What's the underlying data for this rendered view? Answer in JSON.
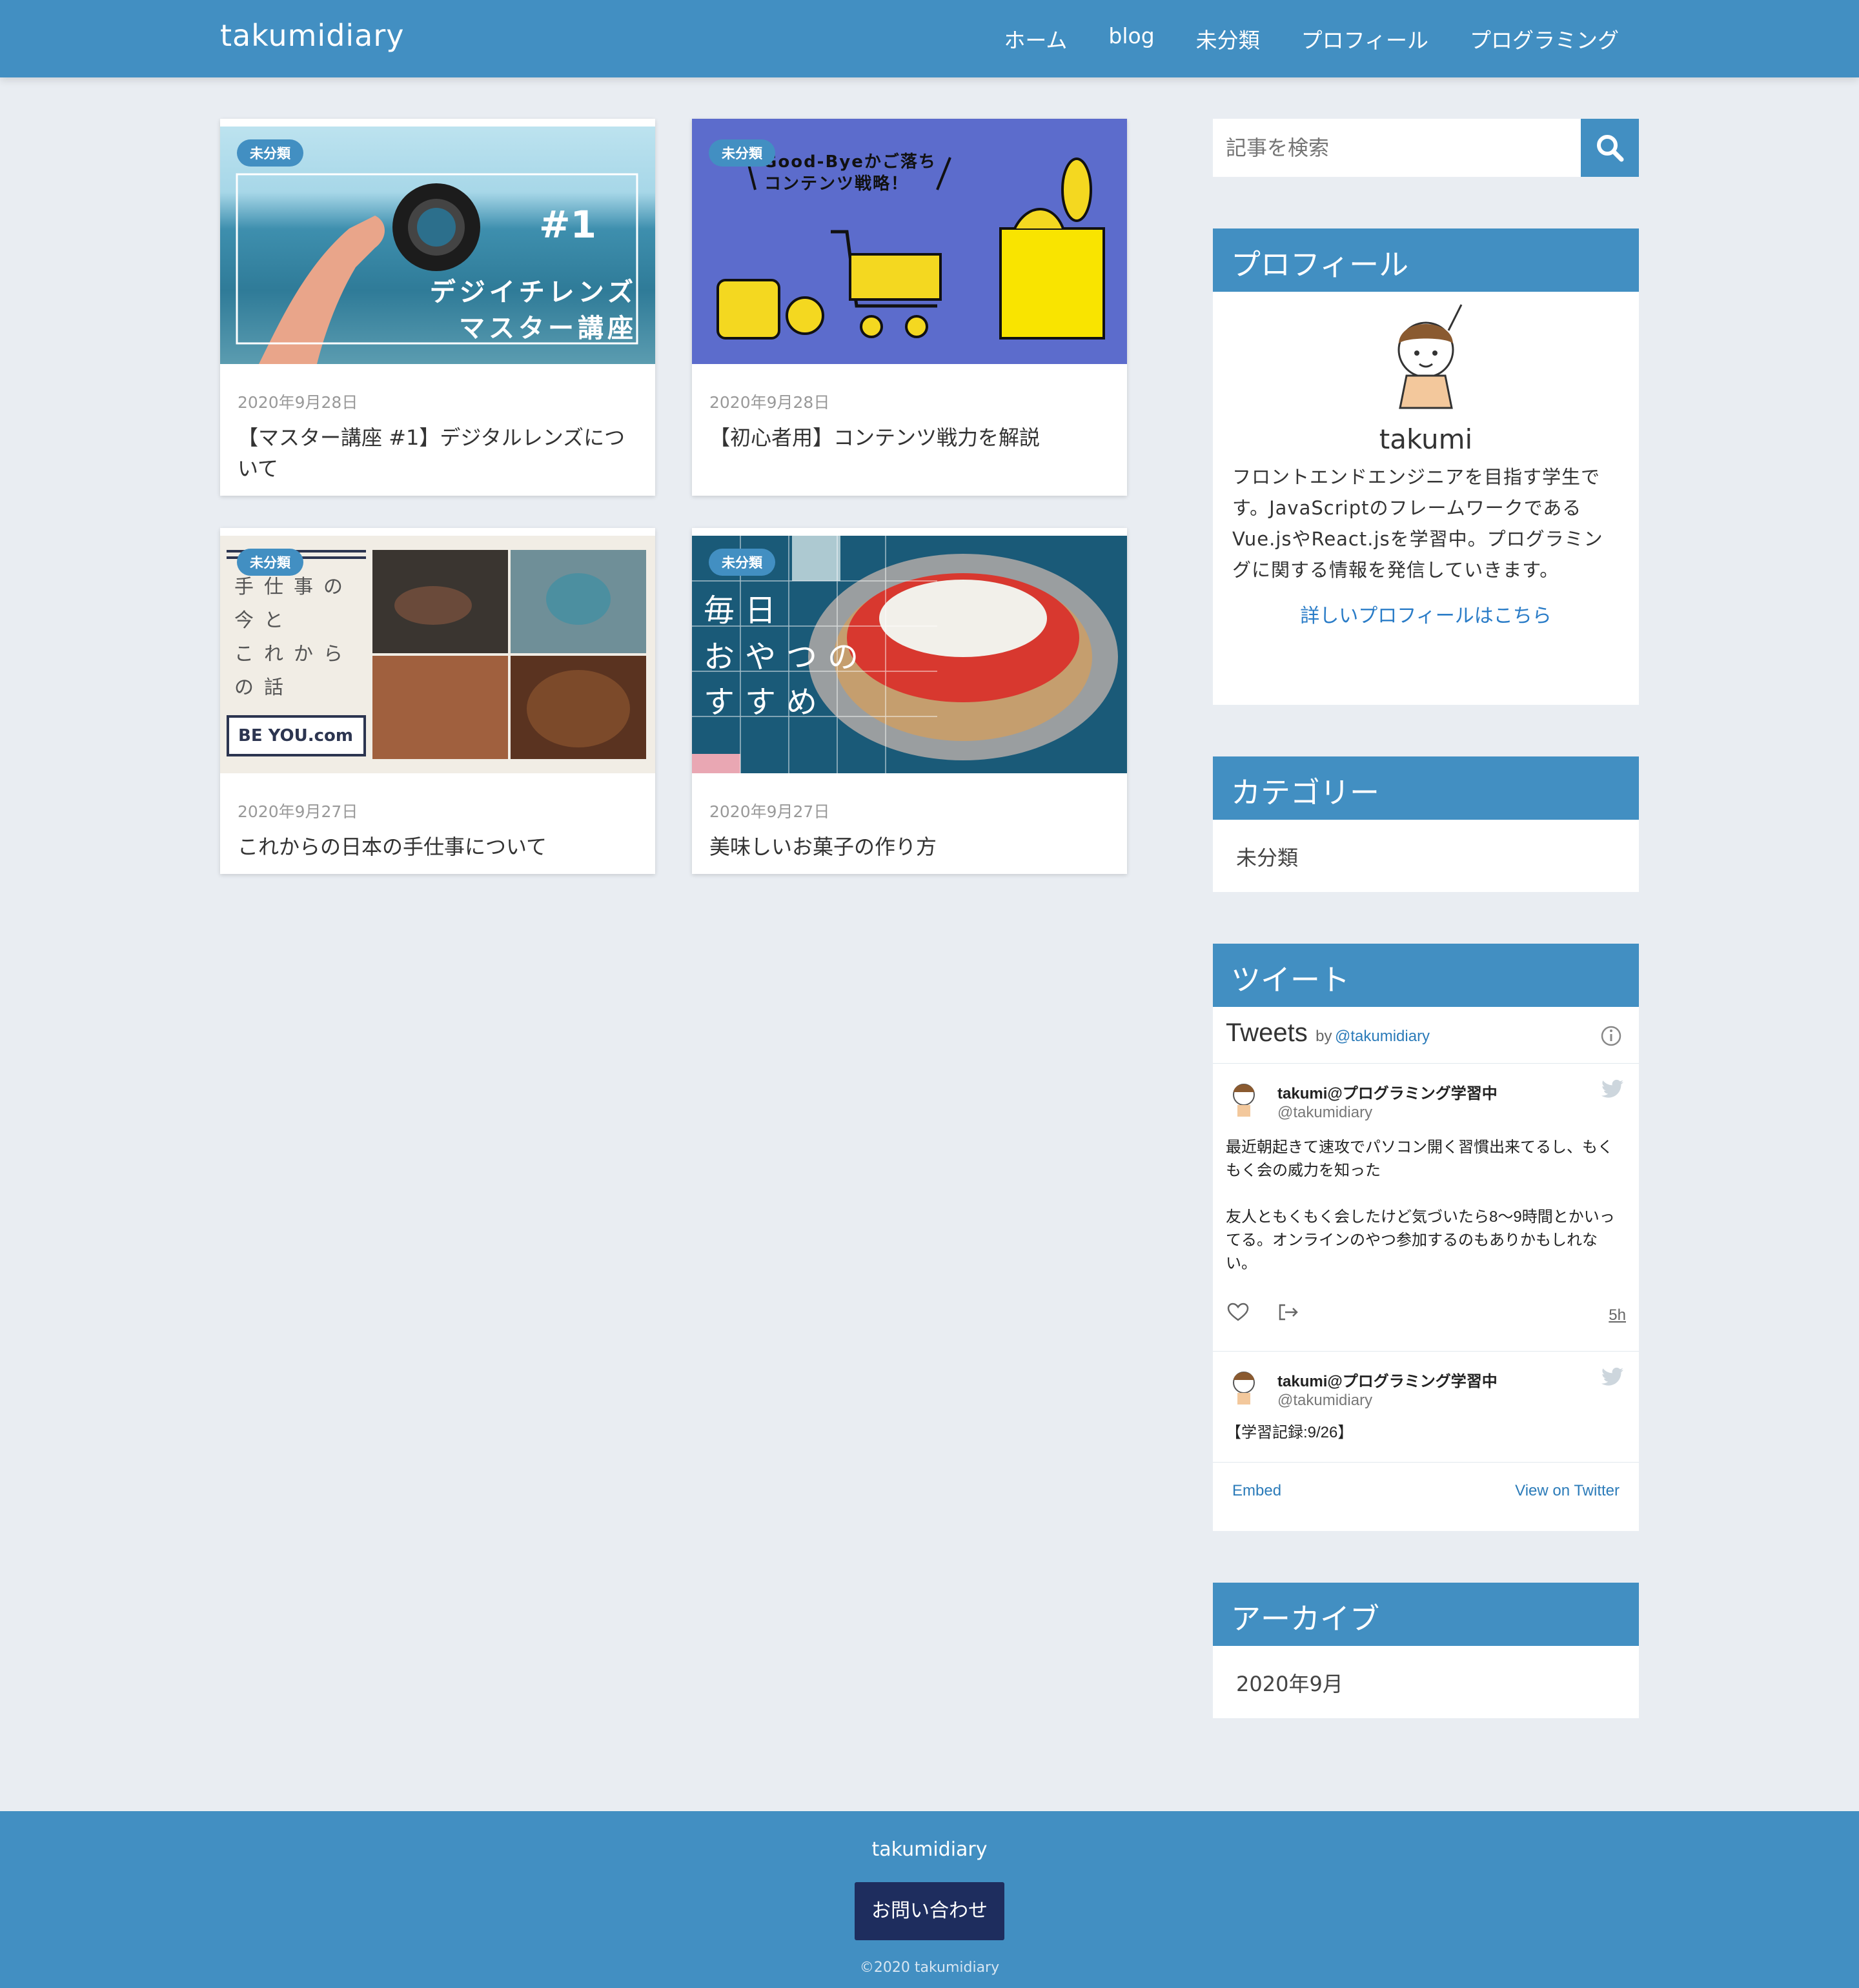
{
  "header": {
    "site_title": "takumidiary",
    "nav": [
      "ホーム",
      "blog",
      "未分類",
      "プロフィール",
      "プログラミング"
    ]
  },
  "posts": [
    {
      "category": "未分類",
      "date": "2020年9月28日",
      "title": "【マスター講座 #1】デジタルレンズについて",
      "thumb_text": [
        "#1",
        "デジイチレンズ",
        "マスター講座"
      ]
    },
    {
      "category": "未分類",
      "date": "2020年9月28日",
      "title": "【初心者用】コンテンツ戦力を解説",
      "thumb_text": [
        "Good-Byeかご落ち",
        "コンテンツ戦略！"
      ]
    },
    {
      "category": "未分類",
      "date": "2020年9月27日",
      "title": "これからの日本の手仕事について",
      "thumb_text": [
        "手仕事の",
        "今と",
        "これから",
        "の話",
        "BE YOU.com"
      ]
    },
    {
      "category": "未分類",
      "date": "2020年9月27日",
      "title": "美味しいお菓子の作り方",
      "thumb_text": [
        "毎日",
        "おやつの",
        "すすめ"
      ]
    }
  ],
  "sidebar": {
    "search_placeholder": "記事を検索",
    "profile": {
      "heading": "プロフィール",
      "name": "takumi",
      "bio": "フロントエンドエンジニアを目指す学生です。JavaScriptのフレームワークであるVue.jsやReact.jsを学習中。プログラミングに関する情報を発信していきます。",
      "link": "詳しいプロフィールはこちら"
    },
    "categories": {
      "heading": "カテゴリー",
      "items": [
        "未分類"
      ]
    },
    "tweets": {
      "heading": "ツイート",
      "label": "Tweets",
      "by": "by",
      "handle": "@takumidiary",
      "items": [
        {
          "user": "takumi@プログラミング学習中",
          "handle": "@takumidiary",
          "text": "最近朝起きて速攻でパソコン開く習慣出来てるし、もくもく会の威力を知った\n\n友人ともくもく会したけど気づいたら8〜9時間とかいってる。オンラインのやつ参加するのもありかもしれない。",
          "time": "5h"
        },
        {
          "user": "takumi@プログラミング学習中",
          "handle": "@takumidiary",
          "text": "【学習記録:9/26】"
        }
      ],
      "embed": "Embed",
      "view": "View on Twitter"
    },
    "archive": {
      "heading": "アーカイブ",
      "items": [
        "2020年9月"
      ]
    }
  },
  "footer": {
    "title": "takumidiary",
    "contact": "お問い合わせ",
    "copyright": "©2020 takumidiary"
  },
  "colors": {
    "primary": "#428fc2",
    "background": "#e9edf2",
    "footer_button": "#1e2d5e",
    "link": "#2a7cc7"
  }
}
